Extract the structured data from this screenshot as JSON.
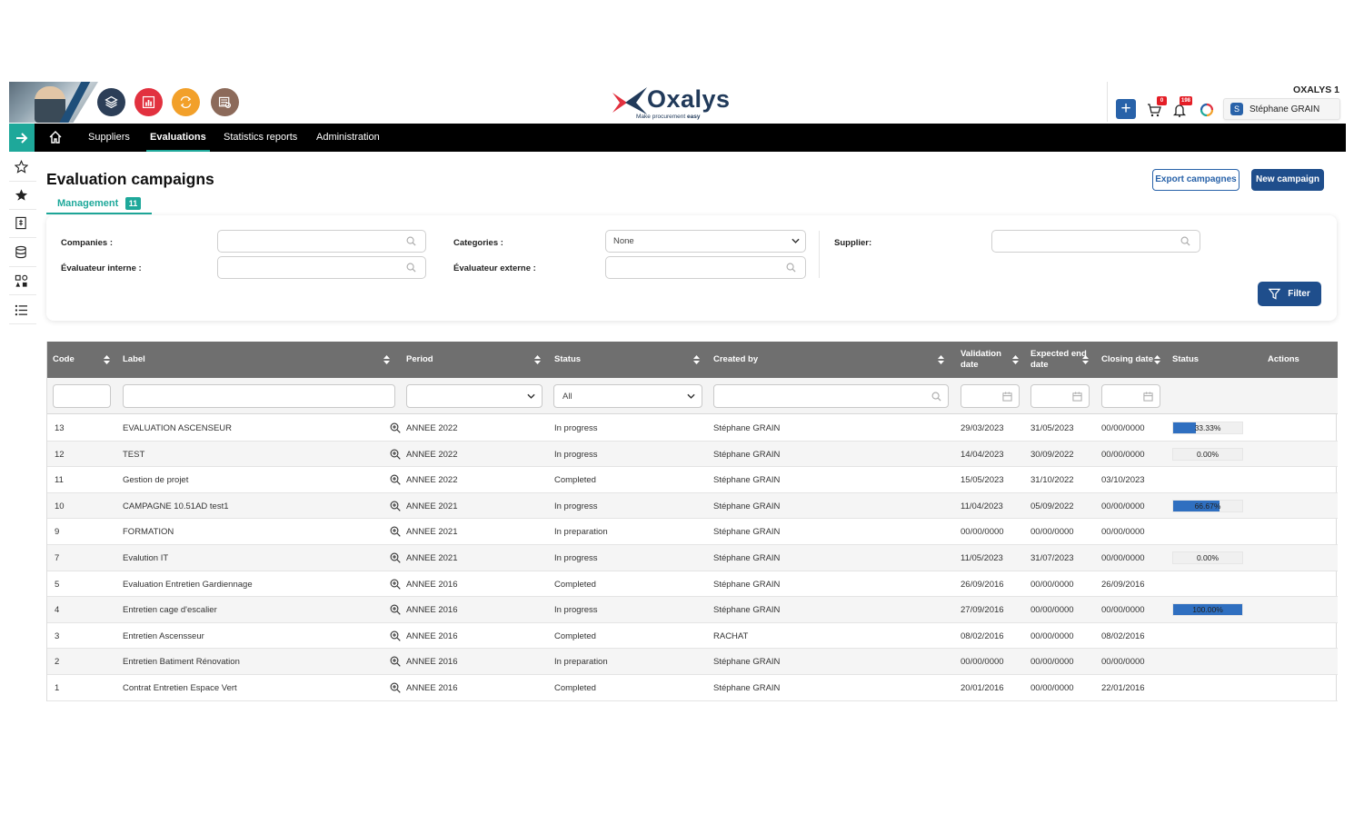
{
  "header": {
    "logo_word": "Oxalys",
    "logo_tagline_prefix": "Make procurement ",
    "logo_tagline_bold": "easy",
    "company_name": "OXALYS 1",
    "cart_badge": "0",
    "notifications_badge": "198",
    "user_initial": "S",
    "user_name": "Stéphane GRAIN",
    "app_colors": [
      "#2c3e57",
      "#e2313f",
      "#f2a02a",
      "#8c6a5a"
    ]
  },
  "nav": {
    "items": [
      "Suppliers",
      "Evaluations",
      "Statistics reports",
      "Administration"
    ],
    "active": "Evaluations",
    "accent_color": "#1ea89a"
  },
  "page": {
    "title": "Evaluation campaigns",
    "tab_label": "Management",
    "tab_count": "11",
    "export_button": "Export campagnes",
    "new_button": "New campaign"
  },
  "filters": {
    "companies_label": "Companies :",
    "categories_label": "Categories :",
    "categories_value": "None",
    "supplier_label": "Supplier:",
    "internal_label": "Évaluateur interne :",
    "external_label": "Évaluateur externe :",
    "filter_button": "Filter"
  },
  "table": {
    "headers": {
      "code": "Code",
      "label": "Label",
      "period": "Period",
      "status": "Status",
      "created_by": "Created by",
      "validation_date": "Validation date",
      "expected_end_date": "Expected end date",
      "closing_date": "Closing date",
      "progress_status": "Status",
      "actions": "Actions"
    },
    "status_filter_value": "All",
    "rows": [
      {
        "code": "13",
        "label": "EVALUATION ASCENSEUR",
        "period": "ANNEE 2022",
        "status": "In progress",
        "created_by": "Stéphane GRAIN",
        "validation": "29/03/2023",
        "expected": "31/05/2023",
        "closing": "00/00/0000",
        "progress_text": "33.33%",
        "progress": 33.33
      },
      {
        "code": "12",
        "label": "TEST",
        "period": "ANNEE 2022",
        "status": "In progress",
        "created_by": "Stéphane GRAIN",
        "validation": "14/04/2023",
        "expected": "30/09/2022",
        "closing": "00/00/0000",
        "progress_text": "0.00%",
        "progress": 0
      },
      {
        "code": "11",
        "label": "Gestion de projet",
        "period": "ANNEE 2022",
        "status": "Completed",
        "created_by": "Stéphane GRAIN",
        "validation": "15/05/2023",
        "expected": "31/10/2022",
        "closing": "03/10/2023",
        "progress_text": null,
        "progress": null
      },
      {
        "code": "10",
        "label": "CAMPAGNE 10.51AD test1",
        "period": "ANNEE 2021",
        "status": "In progress",
        "created_by": "Stéphane GRAIN",
        "validation": "11/04/2023",
        "expected": "05/09/2022",
        "closing": "00/00/0000",
        "progress_text": "66.67%",
        "progress": 66.67
      },
      {
        "code": "9",
        "label": "FORMATION",
        "period": "ANNEE 2021",
        "status": "In preparation",
        "created_by": "Stéphane GRAIN",
        "validation": "00/00/0000",
        "expected": "00/00/0000",
        "closing": "00/00/0000",
        "progress_text": null,
        "progress": null
      },
      {
        "code": "7",
        "label": "Evalution IT",
        "period": "ANNEE 2021",
        "status": "In progress",
        "created_by": "Stéphane GRAIN",
        "validation": "11/05/2023",
        "expected": "31/07/2023",
        "closing": "00/00/0000",
        "progress_text": "0.00%",
        "progress": 0
      },
      {
        "code": "5",
        "label": "Evaluation Entretien Gardiennage",
        "period": "ANNEE 2016",
        "status": "Completed",
        "created_by": "Stéphane GRAIN",
        "validation": "26/09/2016",
        "expected": "00/00/0000",
        "closing": "26/09/2016",
        "progress_text": null,
        "progress": null
      },
      {
        "code": "4",
        "label": "Entretien cage d'escalier",
        "period": "ANNEE 2016",
        "status": "In progress",
        "created_by": "Stéphane GRAIN",
        "validation": "27/09/2016",
        "expected": "00/00/0000",
        "closing": "00/00/0000",
        "progress_text": "100.00%",
        "progress": 100
      },
      {
        "code": "3",
        "label": "Entretien Ascensseur",
        "period": "ANNEE 2016",
        "status": "Completed",
        "created_by": "RACHAT",
        "validation": "08/02/2016",
        "expected": "00/00/0000",
        "closing": "08/02/2016",
        "progress_text": null,
        "progress": null
      },
      {
        "code": "2",
        "label": "Entretien Batiment Rénovation",
        "period": "ANNEE 2016",
        "status": "In preparation",
        "created_by": "Stéphane GRAIN",
        "validation": "00/00/0000",
        "expected": "00/00/0000",
        "closing": "00/00/0000",
        "progress_text": null,
        "progress": null
      },
      {
        "code": "1",
        "label": "Contrat Entretien Espace Vert",
        "period": "ANNEE 2016",
        "status": "Completed",
        "created_by": "Stéphane GRAIN",
        "validation": "20/01/2016",
        "expected": "00/00/0000",
        "closing": "22/01/2016",
        "progress_text": null,
        "progress": null
      }
    ]
  }
}
